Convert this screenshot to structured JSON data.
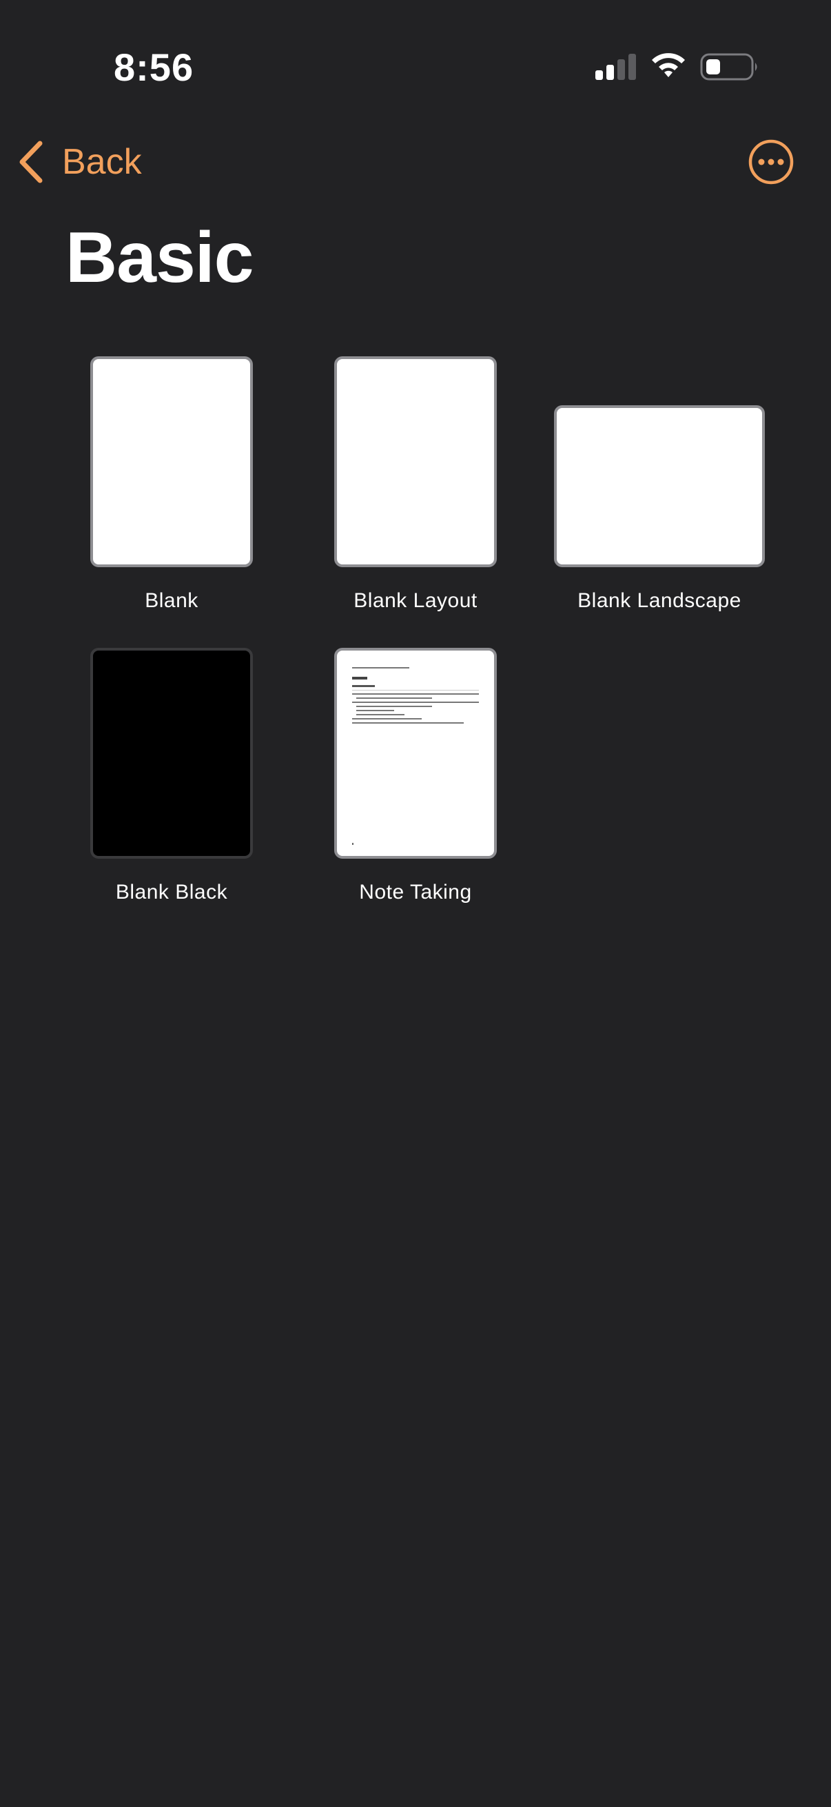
{
  "status_bar": {
    "time": "8:56"
  },
  "nav": {
    "back_label": "Back",
    "more_icon": "ellipsis-circle-icon",
    "accent_color": "#f2a05c"
  },
  "page": {
    "title": "Basic"
  },
  "templates": [
    {
      "label": "Blank",
      "style": "white-portrait"
    },
    {
      "label": "Blank Layout",
      "style": "white-portrait"
    },
    {
      "label": "Blank Landscape",
      "style": "white-landscape"
    },
    {
      "label": "Blank Black",
      "style": "black-portrait"
    },
    {
      "label": "Note Taking",
      "style": "note-portrait"
    }
  ],
  "colors": {
    "background": "#222224",
    "accent": "#f2a05c",
    "thumb_border": "#8e8e92"
  }
}
